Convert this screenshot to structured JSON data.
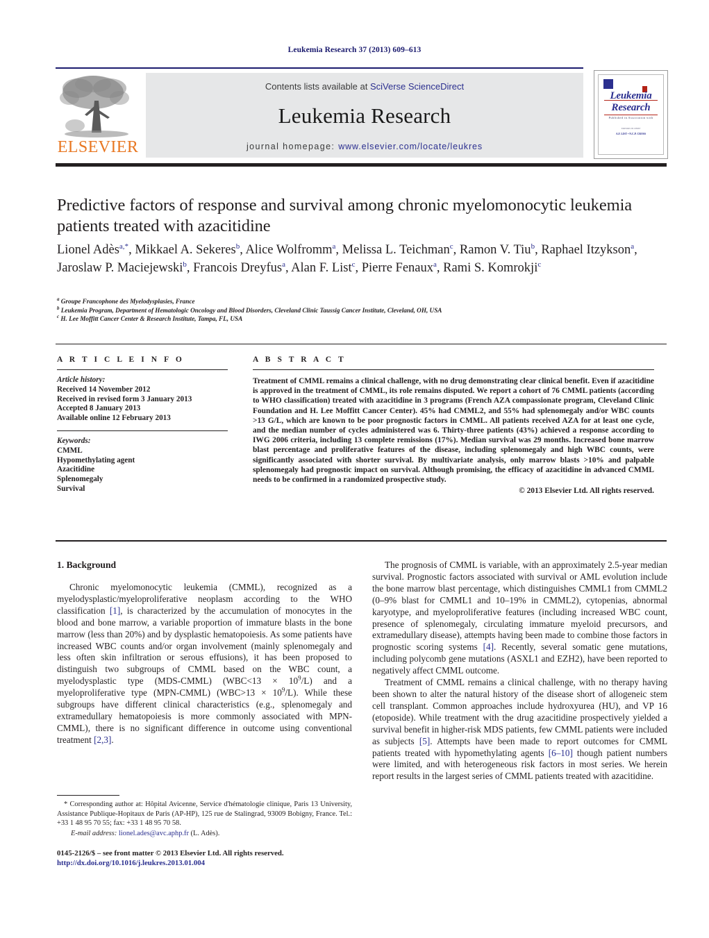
{
  "running_head": "Leukemia Research 37 (2013) 609–613",
  "masthead": {
    "contents_prefix": "Contents lists available at ",
    "sciencedirect": "SciVerse ScienceDirect",
    "journal_name": "Leukemia Research",
    "homepage_prefix": "journal homepage: ",
    "homepage_url": "www.elsevier.com/locate/leukres",
    "publisher_logo_text": "ELSEVIER",
    "cover": {
      "line1": "Leukemia",
      "line2": "Research",
      "subtitle": "Published in Association with",
      "minor": "EDITORS IN CHIEF",
      "names": "A.F. LIST   •   N.C.P. CROSS"
    }
  },
  "article": {
    "title": "Predictive factors of response and survival among chronic myelomonocytic leukemia patients treated with azacitidine",
    "authors_html": "Lionel Adès<sup>a,*</sup>, Mikkael A. Sekeres<sup>b</sup>, Alice Wolfromm<sup>a</sup>, Melissa L. Teichman<sup>c</sup>, Ramon V. Tiu<sup>b</sup>, Raphael Itzykson<sup>a</sup>, Jaroslaw P. Maciejewski<sup>b</sup>, Francois Dreyfus<sup>a</sup>, Alan F. List<sup>c</sup>, Pierre Fenaux<sup>a</sup>, Rami S. Komrokji<sup>c</sup>",
    "affiliations_html": "<sup>a</sup> Groupe Francophone des Myelodysplasies, France<br><sup>b</sup> Leukemia Program, Department of Hematologic Oncology and Blood Disorders, Cleveland Clinic Taussig Cancer Institute, Cleveland, OH, USA<br><sup>c</sup> H. Lee Moffitt Cancer Center &amp; Research Institute, Tampa, FL, USA"
  },
  "info": {
    "heading": "A R T I C L E    I N F O",
    "history_label": "Article history:",
    "history_html": "<span class=\"ital\">Article history:</span><br>Received 14 November 2012<br>Received in revised form 3 January 2013<br>Accepted 8 January 2013<br>Available online 12 February 2013",
    "keywords_html": "<span class=\"ital\">Keywords:</span><br>CMML<br>Hypomethylating agent<br>Azacitidine<br>Splenomegaly<br>Survival",
    "history_items": [
      "Received 14 November 2012",
      "Received in revised form 3 January 2013",
      "Accepted 8 January 2013",
      "Available online 12 February 2013"
    ],
    "keywords_label": "Keywords:",
    "keywords": [
      "CMML",
      "Hypomethylating agent",
      "Azacitidine",
      "Splenomegaly",
      "Survival"
    ]
  },
  "abstract": {
    "heading": "A B S T R A C T",
    "text": "Treatment of CMML remains a clinical challenge, with no drug demonstrating clear clinical benefit. Even if azacitidine is approved in the treatment of CMML, its role remains disputed. We report a cohort of 76 CMML patients (according to WHO classification) treated with azacitidine in 3 programs (French AZA compassionate program, Cleveland Clinic Foundation and H. Lee Moffitt Cancer Center). 45% had CMML2, and 55% had splenomegaly and/or WBC counts >13 G/L, which are known to be poor prognostic factors in CMML. All patients received AZA for at least one cycle, and the median number of cycles administered was 6. Thirty-three patients (43%) achieved a response according to IWG 2006 criteria, including 13 complete remissions (17%). Median survival was 29 months. Increased bone marrow blast percentage and proliferative features of the disease, including splenomegaly and high WBC counts, were significantly associated with shorter survival. By multivariate analysis, only marrow blasts >10% and palpable splenomegaly had prognostic impact on survival. Although promising, the efficacy of azacitidine in advanced CMML needs to be confirmed in a randomized prospective study.",
    "copyright": "© 2013 Elsevier Ltd. All rights reserved."
  },
  "body": {
    "section_heading": "1. Background",
    "left_paragraphs_html": [
      "Chronic myelomonocytic leukemia (CMML), recognized as a myelodysplastic/myeloproliferative neoplasm according to the WHO classification <span class=\"ref\">[1]</span>, is characterized by the accumulation of monocytes in the blood and bone marrow, a variable proportion of immature blasts in the bone marrow (less than 20%) and by dysplastic hematopoiesis. As some patients have increased WBC counts and/or organ involvement (mainly splenomegaly and less often skin infiltration or serous effusions), it has been proposed to distinguish two subgroups of CMML based on the WBC count, a myelodysplastic type (MDS-CMML) (WBC&lt;13 × 10<sup>9</sup>/L) and a myeloproliferative type (MPN-CMML) (WBC&gt;13 × 10<sup>9</sup>/L). While these subgroups have different clinical characteristics (e.g., splenomegaly and extramedullary hematopoiesis is more commonly associated with MPN-CMML), there is no significant difference in outcome using conventional treatment <span class=\"ref\">[2,3]</span>."
    ],
    "right_paragraphs_html": [
      "The prognosis of CMML is variable, with an approximately 2.5-year median survival. Prognostic factors associated with survival or AML evolution include the bone marrow blast percentage, which distinguishes CMML1 from CMML2 (0–9% blast for CMML1 and 10–19% in CMML2), cytopenias, abnormal karyotype, and myeloproliferative features (including increased WBC count, presence of splenomegaly, circulating immature myeloid precursors, and extramedullary disease), attempts having been made to combine those factors in prognostic scoring systems <span class=\"ref\">[4]</span>. Recently, several somatic gene mutations, including polycomb gene mutations (ASXL1 and EZH2), have been reported to negatively affect CMML outcome.",
      "Treatment of CMML remains a clinical challenge, with no therapy having been shown to alter the natural history of the disease short of allogeneic stem cell transplant. Common approaches include hydroxyurea (HU), and VP 16 (etoposide). While treatment with the drug azacitidine prospectively yielded a survival benefit in higher-risk MDS patients, few CMML patients were included as subjects <span class=\"ref\">[5]</span>. Attempts have been made to report outcomes for CMML patients treated with hypomethylating agents <span class=\"ref\">[6–10]</span> though patient numbers were limited, and with heterogeneous risk factors in most series. We herein report results in the largest series of CMML patients treated with azacitidine."
    ]
  },
  "footnote": {
    "corresponding_html": "<span class=\"lead\">* Corresponding author at: Hôpital Avicenne, Service d'hématologie clinique, Paris 13 University, Assistance Publique-Hopitaux de Paris (AP-HP), 125 rue de Stalingrad, 93009 Bobigny, France. Tel.: +33 1 48 95 70 55; fax: +33 1 48 95 70 58.</span>",
    "email_html": "<span class=\"ital\">E-mail address:</span> <span class=\"link\">lionel.ades@avc.aphp.fr</span> (L. Adès).",
    "copyright_html": "0145-2126/$ – see front matter © 2013 Elsevier Ltd. All rights reserved.<br><span class=\"doi\">http://dx.doi.org/10.1016/j.leukres.2013.01.004</span>"
  }
}
